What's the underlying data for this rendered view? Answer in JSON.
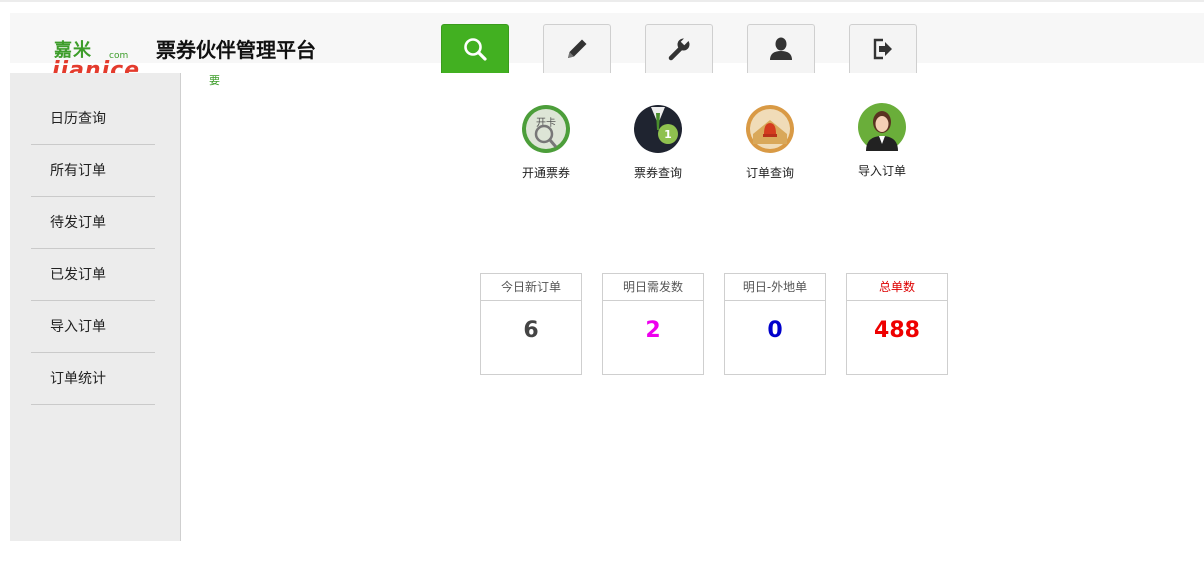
{
  "brand": {
    "logo_cn": "嘉米",
    "logo_com": "com",
    "logo_en": "jianice",
    "title": "票券伙伴管理平台"
  },
  "topnav": [
    {
      "icon": "search-icon",
      "active": true
    },
    {
      "icon": "pencil-icon",
      "active": false
    },
    {
      "icon": "wrench-icon",
      "active": false
    },
    {
      "icon": "user-icon",
      "active": false
    },
    {
      "icon": "logout-icon",
      "active": false
    }
  ],
  "breadcrumb": "要",
  "sidebar": {
    "items": [
      {
        "label": "日历查询"
      },
      {
        "label": "所有订单"
      },
      {
        "label": "待发订单"
      },
      {
        "label": "已发订单"
      },
      {
        "label": "导入订单"
      },
      {
        "label": "订单统计"
      }
    ]
  },
  "quick_links": [
    {
      "label": "开通票券",
      "icon": "card-search-icon",
      "badge": "开卡"
    },
    {
      "label": "票券查询",
      "icon": "suit-icon",
      "badge": "1"
    },
    {
      "label": "订单查询",
      "icon": "bell-envelope-icon"
    },
    {
      "label": "导入订单",
      "icon": "operator-icon"
    }
  ],
  "stats": [
    {
      "label": "今日新订单",
      "value": "6",
      "color": "#444444",
      "label_color": "#555555"
    },
    {
      "label": "明日需发数",
      "value": "2",
      "color": "#ee00ee",
      "label_color": "#555555"
    },
    {
      "label": "明日-外地单",
      "value": "0",
      "color": "#0000cc",
      "label_color": "#555555"
    },
    {
      "label": "总单数",
      "value": "488",
      "color": "#ee0000",
      "label_color": "#dd0000"
    }
  ],
  "colors": {
    "accent": "#42b021"
  }
}
